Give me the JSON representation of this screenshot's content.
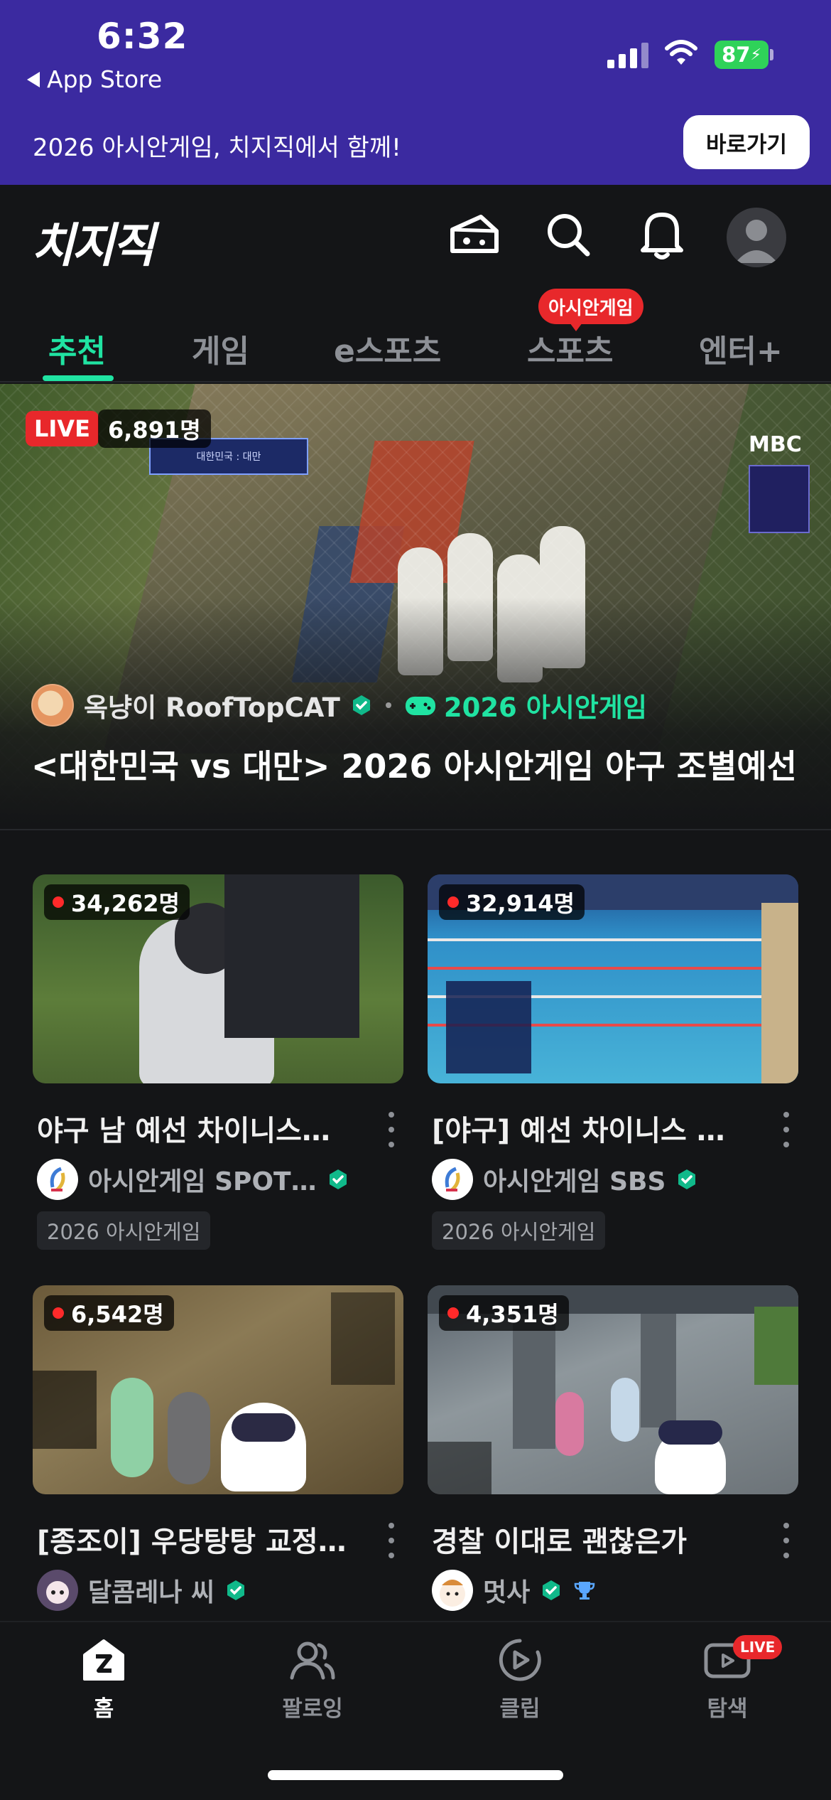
{
  "status_bar": {
    "time": "6:32",
    "back_label": "App Store",
    "battery": "87"
  },
  "promo_banner": {
    "text": "2026 아시안게임, 치지직에서 함께!",
    "button_label": "바로가기"
  },
  "header": {
    "logo_text": "치지직"
  },
  "tabs": [
    {
      "label": "추천",
      "active": true
    },
    {
      "label": "게임"
    },
    {
      "label": "e스포츠"
    },
    {
      "label": "스포츠",
      "badge": "아시안게임"
    },
    {
      "label": "엔터+"
    }
  ],
  "hero": {
    "live_label": "LIVE",
    "viewers": "6,891명",
    "channel": "옥냥이 RoofTopCAT",
    "category": "2026 아시안게임",
    "title": "<대한민국 vs 대만> 2026 아시안게임 야구 조별예선",
    "overlay_score": "대한민국 : 대만",
    "broadcaster": "MBC"
  },
  "cards": [
    {
      "viewers": "34,262명",
      "title": "야구 남 예선 차이니스…",
      "channel": "아시안게임 SPOT…",
      "tag": "2026 아시안게임"
    },
    {
      "viewers": "32,914명",
      "title": "[야구] 예선 차이니스 타…",
      "channel": "아시안게임 SBS",
      "tag": "2026 아시안게임"
    },
    {
      "viewers": "6,542명",
      "title": "[종조이] 우당탕탕 교정...",
      "channel": "달콤레나 씨",
      "tag": ""
    },
    {
      "viewers": "4,351명",
      "title": "경찰 이대로 괜찮은가",
      "channel": "멋사",
      "tag": ""
    }
  ],
  "bottom_nav": [
    {
      "label": "홈",
      "active": true
    },
    {
      "label": "팔로잉"
    },
    {
      "label": "클립"
    },
    {
      "label": "탐색",
      "badge": "LIVE"
    }
  ],
  "colors": {
    "accent": "#20e3a2",
    "banner_bg": "#3b2aa0",
    "live_red": "#e8282b",
    "background": "#141517"
  },
  "icons": [
    "cheese-icon",
    "search-icon",
    "bell-icon",
    "avatar-icon",
    "verified-icon",
    "gamepad-icon",
    "home-icon",
    "following-icon",
    "clip-icon",
    "explore-icon"
  ]
}
